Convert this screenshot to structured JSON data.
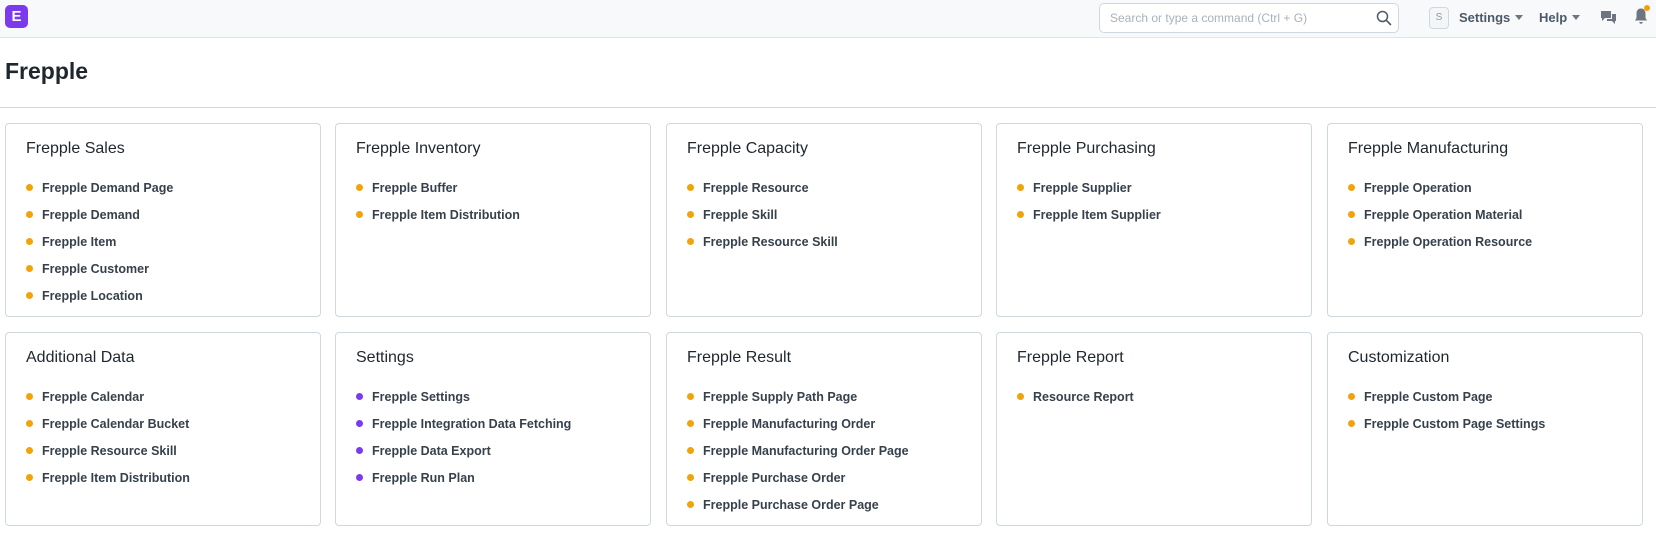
{
  "navbar": {
    "logo_letter": "E",
    "search_placeholder": "Search or type a command (Ctrl + G)",
    "avatar_letter": "S",
    "settings_label": "Settings",
    "help_label": "Help"
  },
  "page": {
    "title": "Frepple"
  },
  "colors": {
    "brand": "#7c3aed",
    "bullet_orange": "#f0a30a",
    "bullet_purple": "#7c3aed",
    "notification": "#f59e0b"
  },
  "cards": [
    {
      "title": "Frepple Sales",
      "dot": "orange",
      "links": [
        "Frepple Demand Page",
        "Frepple Demand",
        "Frepple Item",
        "Frepple Customer",
        "Frepple Location"
      ]
    },
    {
      "title": "Frepple Inventory",
      "dot": "orange",
      "links": [
        "Frepple Buffer",
        "Frepple Item Distribution"
      ]
    },
    {
      "title": "Frepple Capacity",
      "dot": "orange",
      "links": [
        "Frepple Resource",
        "Frepple Skill",
        "Frepple Resource Skill"
      ]
    },
    {
      "title": "Frepple Purchasing",
      "dot": "orange",
      "links": [
        "Frepple Supplier",
        "Frepple Item Supplier"
      ]
    },
    {
      "title": "Frepple Manufacturing",
      "dot": "orange",
      "links": [
        "Frepple Operation",
        "Frepple Operation Material",
        "Frepple Operation Resource"
      ]
    },
    {
      "title": "Additional Data",
      "dot": "orange",
      "links": [
        "Frepple Calendar",
        "Frepple Calendar Bucket",
        "Frepple Resource Skill",
        "Frepple Item Distribution"
      ]
    },
    {
      "title": "Settings",
      "dot": "purple",
      "links": [
        "Frepple Settings",
        "Frepple Integration Data Fetching",
        "Frepple Data Export",
        "Frepple Run Plan"
      ]
    },
    {
      "title": "Frepple Result",
      "dot": "orange",
      "links": [
        "Frepple Supply Path Page",
        "Frepple Manufacturing Order",
        "Frepple Manufacturing Order Page",
        "Frepple Purchase Order",
        "Frepple Purchase Order Page"
      ]
    },
    {
      "title": "Frepple Report",
      "dot": "orange",
      "links": [
        "Resource Report"
      ]
    },
    {
      "title": "Customization",
      "dot": "orange",
      "links": [
        "Frepple Custom Page",
        "Frepple Custom Page Settings"
      ]
    }
  ]
}
